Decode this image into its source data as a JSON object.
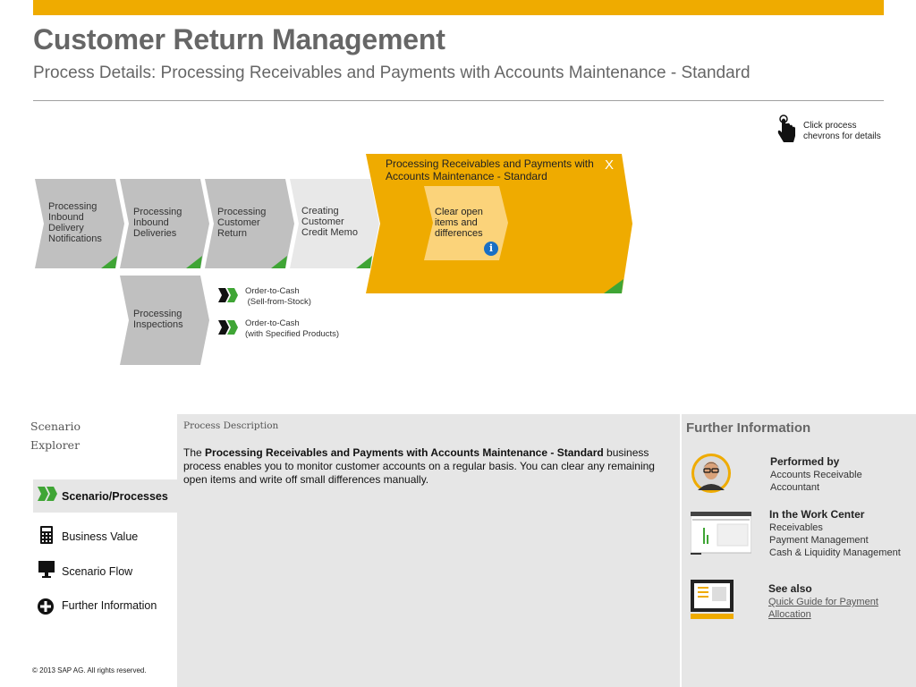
{
  "header": {
    "title": "Customer Return Management",
    "subtitle": "Process Details: Processing Receivables and Payments with Accounts Maintenance - Standard"
  },
  "hint": {
    "text": "Click process chevrons for details",
    "icon": "pointer-hand-icon"
  },
  "process_steps": [
    {
      "label": "Processing Inbound Delivery Notifications",
      "style": "gray"
    },
    {
      "label": "Processing Inbound Deliveries",
      "style": "gray"
    },
    {
      "label": "Processing Customer Return",
      "style": "gray"
    },
    {
      "label": "Creating Customer Credit Memo",
      "style": "light"
    },
    {
      "label": "Processing Inspections",
      "style": "gray"
    }
  ],
  "expanded_step": {
    "title": "Processing Receivables and Payments with Accounts Maintenance - Standard",
    "close_label": "X",
    "sub_step": "Clear open items and differences",
    "info_label": "i"
  },
  "legend": [
    {
      "line1": "Order-to-Cash",
      "line2": " (Sell-from-Stock)"
    },
    {
      "line1": "Order-to-Cash",
      "line2": "(with Specified Products)"
    }
  ],
  "explorer": {
    "heading_line1": "Scenario",
    "heading_line2": "Explorer",
    "items": [
      {
        "label": "Scenario/Processes",
        "icon": "double-chevron-icon",
        "active": true
      },
      {
        "label": "Business Value",
        "icon": "calculator-icon",
        "active": false
      },
      {
        "label": "Scenario Flow",
        "icon": "monitor-icon",
        "active": false
      },
      {
        "label": "Further Information",
        "icon": "plus-circle-icon",
        "active": false
      }
    ]
  },
  "description": {
    "heading": "Process Description",
    "intro": "The ",
    "bold": "Processing Receivables and Payments with Accounts Maintenance - Standard",
    "rest": " business process enables you to monitor customer accounts on a regular basis. You can clear any remaining open items and write off small differences manually."
  },
  "further_info": {
    "heading": "Further Information",
    "performed_by": {
      "title": "Performed by",
      "line1": "Accounts Receivable",
      "line2": "Accountant"
    },
    "work_center": {
      "title": "In the Work Center",
      "line1": "Receivables",
      "line2": "Payment Management",
      "line3": "Cash & Liquidity Management"
    },
    "see_also": {
      "title": "See also",
      "link_line1": "Quick Guide for Payment",
      "link_line2": "Allocation"
    }
  },
  "footer": {
    "copyright": "©  2013 SAP AG. All rights reserved."
  },
  "colors": {
    "accent": "#efab00",
    "gray_chevron": "#c0c0c0",
    "light_chevron": "#e8e8e8",
    "green": "#3fa535",
    "info_blue": "#1a6fc4"
  }
}
